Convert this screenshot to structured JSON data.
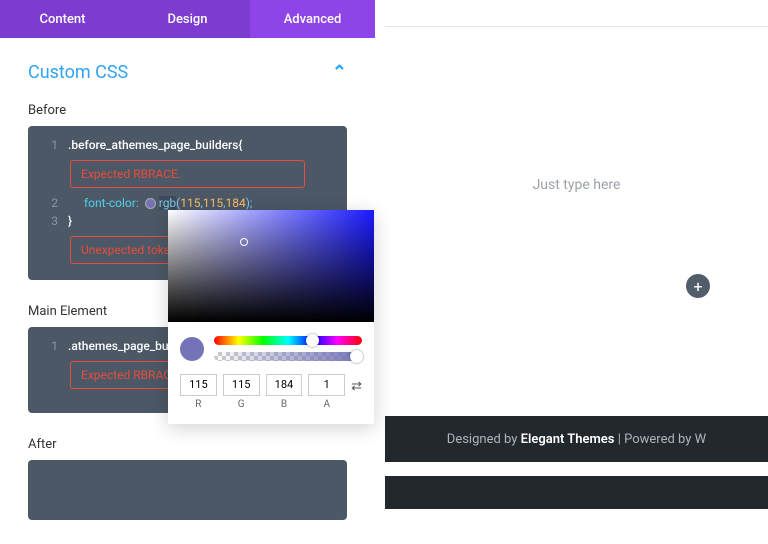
{
  "tabs": {
    "content": "Content",
    "design": "Design",
    "advanced": "Advanced"
  },
  "section": {
    "title": "Custom CSS"
  },
  "before": {
    "label": "Before",
    "line1": ".before_athemes_page_builders{",
    "err1": "Expected RBRACE.",
    "prop": "font-color:",
    "fn": "rgb",
    "r": "115",
    "g": "115",
    "b": "184",
    "close": ");",
    "brace": "}",
    "err2": "Unexpected toke"
  },
  "main": {
    "label": "Main Element",
    "line1": ".athemes_page_bu",
    "err1": "Expected RBRACE"
  },
  "after": {
    "label": "After"
  },
  "preview": {
    "placeholder": "Just type here"
  },
  "footer": {
    "prefix": "Designed by ",
    "brand": "Elegant Themes",
    "suffix": " | Powered by W"
  },
  "picker": {
    "r": "115",
    "g": "115",
    "b": "184",
    "a": "1",
    "rl": "R",
    "gl": "G",
    "bl": "B",
    "al": "A"
  }
}
